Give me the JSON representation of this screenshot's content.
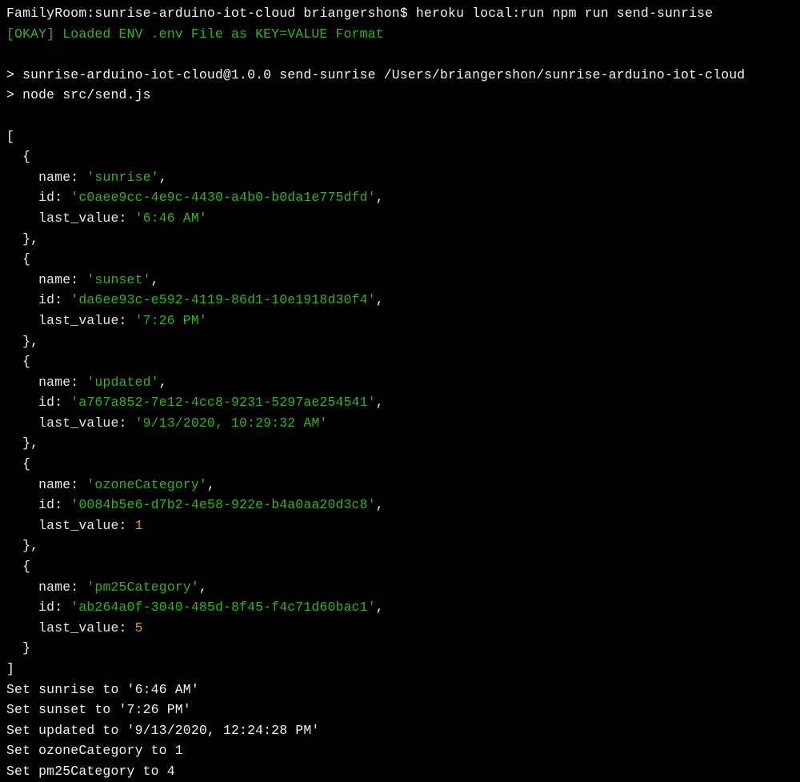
{
  "prompt": {
    "host": "FamilyRoom",
    "cwd": "sunrise-arduino-iot-cloud",
    "user": "briangershon",
    "sep": "$",
    "cmd": "heroku local:run npm run send-sunrise"
  },
  "okay_line": "[OKAY] Loaded ENV .env File as KEY=VALUE Format",
  "npm_info1": "> sunrise-arduino-iot-cloud@1.0.0 send-sunrise /Users/briangershon/sunrise-arduino-iot-cloud",
  "npm_info2": "> node src/send.js",
  "arr_open": "[",
  "arr_close": "]",
  "brace_open": "  {",
  "brace_close_comma": "  },",
  "brace_close": "  }",
  "key_name": "    name: ",
  "key_id": "    id: ",
  "key_last": "    last_value: ",
  "comma": ",",
  "entries": [
    {
      "name": "'sunrise'",
      "id": "'c0aee9cc-4e9c-4430-a4b0-b0da1e775dfd'",
      "last_value": "'6:46 AM'",
      "last_is_num": false
    },
    {
      "name": "'sunset'",
      "id": "'da6ee93c-e592-4119-86d1-10e1918d30f4'",
      "last_value": "'7:26 PM'",
      "last_is_num": false
    },
    {
      "name": "'updated'",
      "id": "'a767a852-7e12-4cc8-9231-5297ae254541'",
      "last_value": "'9/13/2020, 10:29:32 AM'",
      "last_is_num": false
    },
    {
      "name": "'ozoneCategory'",
      "id": "'0084b5e6-d7b2-4e58-922e-b4a0aa20d3c8'",
      "last_value": "1",
      "last_is_num": true
    },
    {
      "name": "'pm25Category'",
      "id": "'ab264a0f-3040-485d-8f45-f4c71d60bac1'",
      "last_value": "5",
      "last_is_num": true
    }
  ],
  "set_lines": [
    "Set sunrise to '6:46 AM'",
    "Set sunset to '7:26 PM'",
    "Set updated to '9/13/2020, 12:24:28 PM'",
    "Set ozoneCategory to 1",
    "Set pm25Category to 4"
  ]
}
